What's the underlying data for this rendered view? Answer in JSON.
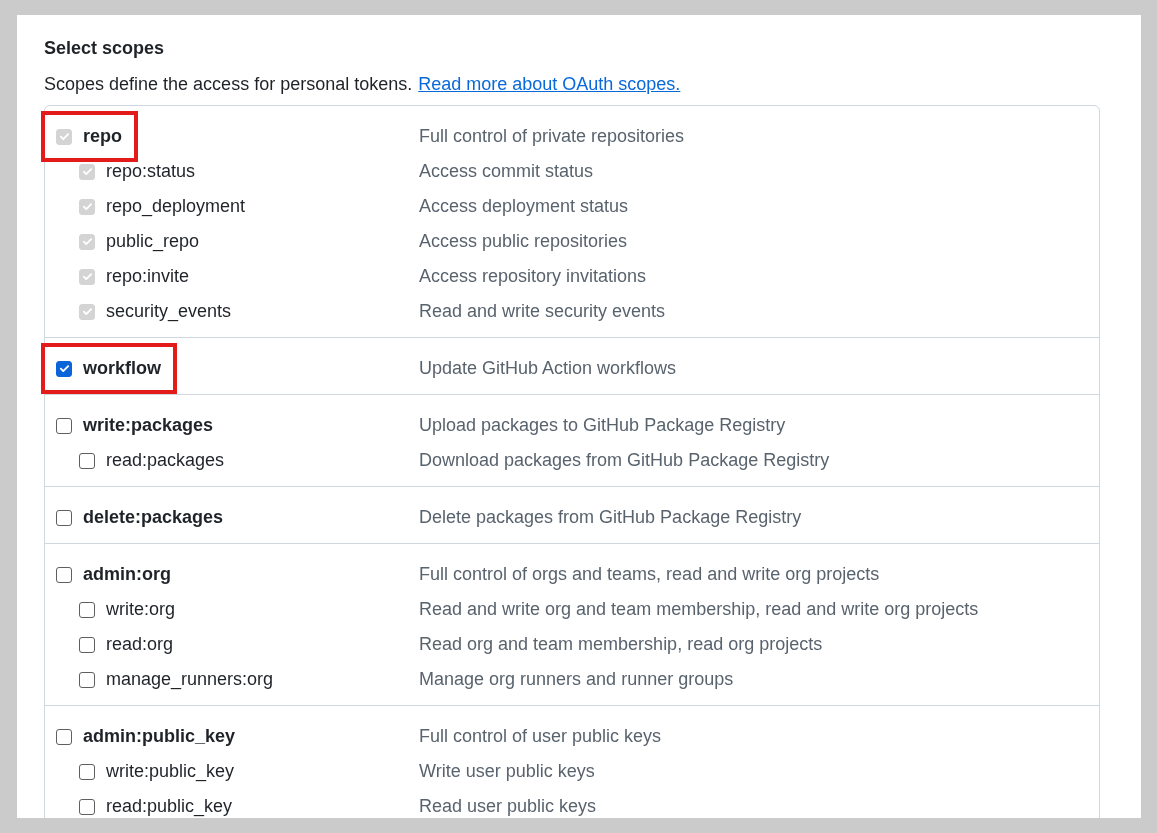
{
  "heading": "Select scopes",
  "intro": {
    "text": "Scopes define the access for personal tokens.",
    "link": "Read more about OAuth scopes."
  },
  "groups": [
    {
      "name": "repo",
      "description": "Full control of private repositories",
      "checked": true,
      "disabled": true,
      "highlighted": true,
      "children": [
        {
          "name": "repo:status",
          "description": "Access commit status",
          "checked": true,
          "disabled": true
        },
        {
          "name": "repo_deployment",
          "description": "Access deployment status",
          "checked": true,
          "disabled": true
        },
        {
          "name": "public_repo",
          "description": "Access public repositories",
          "checked": true,
          "disabled": true
        },
        {
          "name": "repo:invite",
          "description": "Access repository invitations",
          "checked": true,
          "disabled": true
        },
        {
          "name": "security_events",
          "description": "Read and write security events",
          "checked": true,
          "disabled": true
        }
      ]
    },
    {
      "name": "workflow",
      "description": "Update GitHub Action workflows",
      "checked": true,
      "disabled": false,
      "highlighted": true
    },
    {
      "name": "write:packages",
      "description": "Upload packages to GitHub Package Registry",
      "checked": false,
      "disabled": false,
      "highlighted": false,
      "children": [
        {
          "name": "read:packages",
          "description": "Download packages from GitHub Package Registry",
          "checked": false,
          "disabled": false
        }
      ]
    },
    {
      "name": "delete:packages",
      "description": "Delete packages from GitHub Package Registry",
      "checked": false,
      "disabled": false,
      "highlighted": false
    },
    {
      "name": "admin:org",
      "description": "Full control of orgs and teams, read and write org projects",
      "checked": false,
      "disabled": false,
      "highlighted": false,
      "children": [
        {
          "name": "write:org",
          "description": "Read and write org and team membership, read and write org projects",
          "checked": false,
          "disabled": false
        },
        {
          "name": "read:org",
          "description": "Read org and team membership, read org projects",
          "checked": false,
          "disabled": false
        },
        {
          "name": "manage_runners:org",
          "description": "Manage org runners and runner groups",
          "checked": false,
          "disabled": false
        }
      ]
    },
    {
      "name": "admin:public_key",
      "description": "Full control of user public keys",
      "checked": false,
      "disabled": false,
      "highlighted": false,
      "children": [
        {
          "name": "write:public_key",
          "description": "Write user public keys",
          "checked": false,
          "disabled": false
        },
        {
          "name": "read:public_key",
          "description": "Read user public keys",
          "checked": false,
          "disabled": false
        }
      ]
    }
  ]
}
